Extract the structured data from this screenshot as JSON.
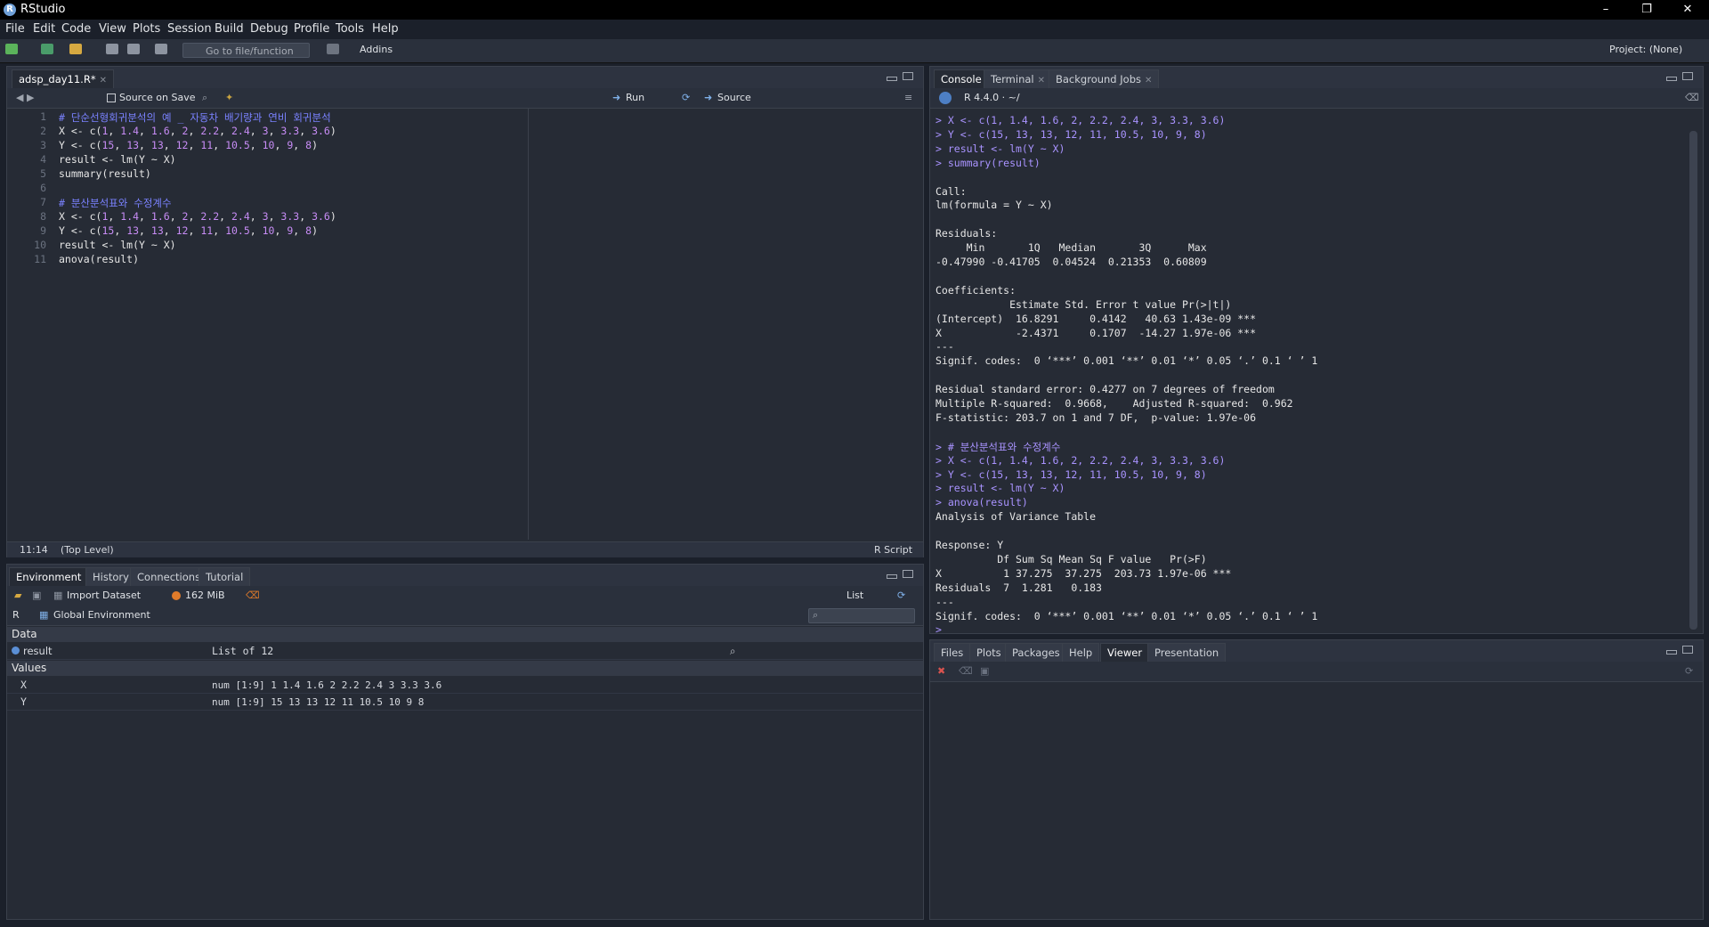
{
  "app": {
    "title": "RStudio",
    "project": "Project: (None)"
  },
  "window": {
    "minimize": "–",
    "restore": "❐",
    "close": "✕"
  },
  "menu": [
    "File",
    "Edit",
    "Code",
    "View",
    "Plots",
    "Session",
    "Build",
    "Debug",
    "Profile",
    "Tools",
    "Help"
  ],
  "toolbar": {
    "goto_placeholder": "Go to file/function",
    "addins": "Addins"
  },
  "editor": {
    "tab": "adsp_day11.R*",
    "source_on_save": "Source on Save",
    "run": "Run",
    "source": "Source",
    "cursor_pos": "11:14",
    "scope": "(Top Level)",
    "filetype": "R Script",
    "lines": [
      "# 단순선형회귀분석의 예 _ 자동차 배기량과 연비 회귀분석",
      "X <- c(1, 1.4, 1.6, 2, 2.2, 2.4, 3, 3.3, 3.6)",
      "Y <- c(15, 13, 13, 12, 11, 10.5, 10, 9, 8)",
      "result <- lm(Y ~ X)",
      "summary(result)",
      "",
      "# 분산분석표와 수정계수",
      "X <- c(1, 1.4, 1.6, 2, 2.2, 2.4, 3, 3.3, 3.6)",
      "Y <- c(15, 13, 13, 12, 11, 10.5, 10, 9, 8)",
      "result <- lm(Y ~ X)",
      "anova(result)"
    ]
  },
  "console": {
    "tabs": [
      "Console",
      "Terminal",
      "Background Jobs"
    ],
    "version": "R 4.4.0 · ~/",
    "lines": [
      {
        "t": "in",
        "s": "> X <- c(1, 1.4, 1.6, 2, 2.2, 2.4, 3, 3.3, 3.6)"
      },
      {
        "t": "in",
        "s": "> Y <- c(15, 13, 13, 12, 11, 10.5, 10, 9, 8)"
      },
      {
        "t": "in",
        "s": "> result <- lm(Y ~ X)"
      },
      {
        "t": "in",
        "s": "> summary(result)"
      },
      {
        "t": "out",
        "s": ""
      },
      {
        "t": "out",
        "s": "Call:"
      },
      {
        "t": "out",
        "s": "lm(formula = Y ~ X)"
      },
      {
        "t": "out",
        "s": ""
      },
      {
        "t": "out",
        "s": "Residuals:"
      },
      {
        "t": "out",
        "s": "     Min       1Q   Median       3Q      Max "
      },
      {
        "t": "out",
        "s": "-0.47990 -0.41705  0.04524  0.21353  0.60809 "
      },
      {
        "t": "out",
        "s": ""
      },
      {
        "t": "out",
        "s": "Coefficients:"
      },
      {
        "t": "out",
        "s": "            Estimate Std. Error t value Pr(>|t|)    "
      },
      {
        "t": "out",
        "s": "(Intercept)  16.8291     0.4142   40.63 1.43e-09 ***"
      },
      {
        "t": "out",
        "s": "X            -2.4371     0.1707  -14.27 1.97e-06 ***"
      },
      {
        "t": "out",
        "s": "---"
      },
      {
        "t": "out",
        "s": "Signif. codes:  0 ‘***’ 0.001 ‘**’ 0.01 ‘*’ 0.05 ‘.’ 0.1 ‘ ’ 1"
      },
      {
        "t": "out",
        "s": ""
      },
      {
        "t": "out",
        "s": "Residual standard error: 0.4277 on 7 degrees of freedom"
      },
      {
        "t": "out",
        "s": "Multiple R-squared:  0.9668,\tAdjusted R-squared:  0.962 "
      },
      {
        "t": "out",
        "s": "F-statistic: 203.7 on 1 and 7 DF,  p-value: 1.97e-06"
      },
      {
        "t": "out",
        "s": ""
      },
      {
        "t": "in",
        "s": "> # 분산분석표와 수정계수"
      },
      {
        "t": "in",
        "s": "> X <- c(1, 1.4, 1.6, 2, 2.2, 2.4, 3, 3.3, 3.6)"
      },
      {
        "t": "in",
        "s": "> Y <- c(15, 13, 13, 12, 11, 10.5, 10, 9, 8)"
      },
      {
        "t": "in",
        "s": "> result <- lm(Y ~ X)"
      },
      {
        "t": "in",
        "s": "> anova(result)"
      },
      {
        "t": "out",
        "s": "Analysis of Variance Table"
      },
      {
        "t": "out",
        "s": ""
      },
      {
        "t": "out",
        "s": "Response: Y"
      },
      {
        "t": "out",
        "s": "          Df Sum Sq Mean Sq F value   Pr(>F)    "
      },
      {
        "t": "out",
        "s": "X          1 37.275  37.275  203.73 1.97e-06 ***"
      },
      {
        "t": "out",
        "s": "Residuals  7  1.281   0.183                     "
      },
      {
        "t": "out",
        "s": "---"
      },
      {
        "t": "out",
        "s": "Signif. codes:  0 ‘***’ 0.001 ‘**’ 0.01 ‘*’ 0.05 ‘.’ 0.1 ‘ ’ 1"
      },
      {
        "t": "in",
        "s": "> "
      }
    ]
  },
  "environment": {
    "tabs": [
      "Environment",
      "History",
      "Connections",
      "Tutorial"
    ],
    "import_dataset": "Import Dataset",
    "memory": "162 MiB",
    "view_mode": "List",
    "language": "R",
    "scope": "Global Environment",
    "sections": {
      "data": "Data",
      "values": "Values"
    },
    "data_rows": [
      {
        "name": "result",
        "value": "List of  12"
      }
    ],
    "value_rows": [
      {
        "name": "X",
        "value": "num [1:9] 1 1.4 1.6 2 2.2 2.4 3 3.3 3.6"
      },
      {
        "name": "Y",
        "value": "num [1:9] 15 13 13 12 11 10.5 10 9 8"
      }
    ]
  },
  "files": {
    "tabs": [
      "Files",
      "Plots",
      "Packages",
      "Help",
      "Viewer",
      "Presentation"
    ],
    "active": "Viewer"
  }
}
